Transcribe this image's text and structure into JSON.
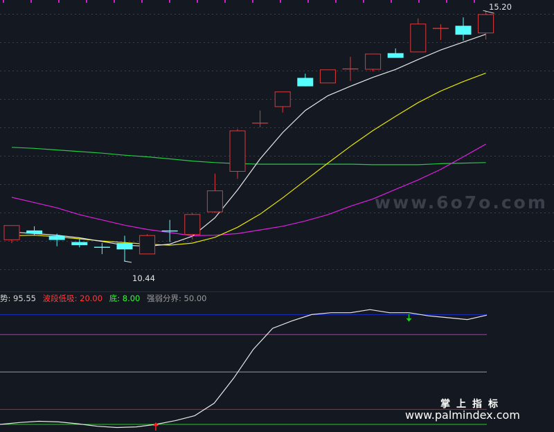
{
  "colors": {
    "background": "#141821",
    "up_candle": "#e0393b",
    "down_candle": "#55ffff",
    "ma_white": "#e8e8e8",
    "ma_yellow": "#e8e800",
    "ma_magenta": "#e020e0",
    "ma_green": "#22cc44",
    "osc_main": "#e8e8e8",
    "level_blue": "#1a2acc",
    "level_magenta": "#cc22cc",
    "level_gray": "#9a9a9a",
    "level_red": "#cc1e1e",
    "level_green": "#22cc22",
    "grid": "#3a3f4b"
  },
  "watermarks": {
    "site1": "www.6o7o.com",
    "brand": "掌上指标",
    "site2": "www.palmindex.com"
  },
  "chart_data": [
    {
      "type": "candlestick",
      "title": "",
      "ylim": [
        9.9,
        15.4
      ],
      "price_labels": {
        "high": "15.20",
        "low": "10.44"
      },
      "candles": [
        {
          "o": 10.85,
          "h": 11.05,
          "l": 10.78,
          "c": 11.12
        },
        {
          "o": 11.02,
          "h": 11.1,
          "l": 10.92,
          "c": 10.96
        },
        {
          "o": 10.92,
          "h": 10.96,
          "l": 10.72,
          "c": 10.84
        },
        {
          "o": 10.8,
          "h": 10.86,
          "l": 10.7,
          "c": 10.74
        },
        {
          "o": 10.71,
          "h": 10.78,
          "l": 10.57,
          "c": 10.69
        },
        {
          "o": 10.78,
          "h": 10.92,
          "l": 10.44,
          "c": 10.66
        },
        {
          "o": 10.58,
          "h": 10.95,
          "l": 10.58,
          "c": 10.93
        },
        {
          "o": 11.02,
          "h": 11.22,
          "l": 10.8,
          "c": 11.0
        },
        {
          "o": 10.95,
          "h": 11.35,
          "l": 10.85,
          "c": 11.33
        },
        {
          "o": 11.38,
          "h": 12.1,
          "l": 11.35,
          "c": 11.78
        },
        {
          "o": 12.15,
          "h": 12.95,
          "l": 12.0,
          "c": 12.92
        },
        {
          "o": 13.06,
          "h": 13.3,
          "l": 12.98,
          "c": 13.06
        },
        {
          "o": 13.38,
          "h": 13.58,
          "l": 13.26,
          "c": 13.66
        },
        {
          "o": 13.92,
          "h": 14.0,
          "l": 13.76,
          "c": 13.76
        },
        {
          "o": 13.83,
          "h": 14.05,
          "l": 13.82,
          "c": 14.08
        },
        {
          "o": 14.09,
          "h": 14.32,
          "l": 13.86,
          "c": 14.09
        },
        {
          "o": 14.09,
          "h": 14.37,
          "l": 14.04,
          "c": 14.38
        },
        {
          "o": 14.39,
          "h": 14.48,
          "l": 14.35,
          "c": 14.3
        },
        {
          "o": 14.42,
          "h": 15.05,
          "l": 14.42,
          "c": 14.95
        },
        {
          "o": 14.86,
          "h": 14.94,
          "l": 14.64,
          "c": 14.86
        },
        {
          "o": 14.91,
          "h": 15.07,
          "l": 14.63,
          "c": 14.74
        },
        {
          "o": 14.78,
          "h": 15.2,
          "l": 14.65,
          "c": 15.13
        }
      ],
      "ma_white": [
        10.99,
        10.96,
        10.93,
        10.88,
        10.81,
        10.74,
        10.72,
        10.76,
        10.91,
        11.26,
        11.79,
        12.38,
        12.88,
        13.3,
        13.58,
        13.76,
        13.93,
        14.08,
        14.27,
        14.45,
        14.6,
        14.75
      ],
      "ma_yellow": [
        10.92,
        10.93,
        10.9,
        10.86,
        10.82,
        10.79,
        10.76,
        10.74,
        10.78,
        10.89,
        11.08,
        11.33,
        11.64,
        11.97,
        12.3,
        12.62,
        12.92,
        13.19,
        13.45,
        13.67,
        13.85,
        14.01
      ],
      "ma_magenta": [
        11.65,
        11.55,
        11.45,
        11.32,
        11.22,
        11.12,
        11.04,
        10.98,
        10.92,
        10.93,
        10.96,
        11.03,
        11.1,
        11.2,
        11.32,
        11.48,
        11.62,
        11.8,
        11.98,
        12.18,
        12.42,
        12.66
      ],
      "ma_green": [
        12.6,
        12.58,
        12.55,
        12.52,
        12.49,
        12.45,
        12.42,
        12.38,
        12.34,
        12.31,
        12.29,
        12.28,
        12.28,
        12.28,
        12.28,
        12.28,
        12.27,
        12.27,
        12.27,
        12.29,
        12.3,
        12.31
      ]
    },
    {
      "type": "line",
      "title": "",
      "ylim": [
        3.0,
        104.0
      ],
      "legend": [
        {
          "label": "势: 95.55",
          "color": "#d8d8d8"
        },
        {
          "label": "波段低吸: 20.00",
          "color": "#ff3b3b"
        },
        {
          "label": "底: 8.00",
          "color": "#33ff33"
        },
        {
          "label": "强弱分界: 50.00",
          "color": "#9a9a9a"
        }
      ],
      "levels": [
        {
          "name": "high",
          "value": 96.0,
          "color": "#1a2acc"
        },
        {
          "name": "mid-high",
          "value": 80.0,
          "color": "#cc22cc"
        },
        {
          "name": "强弱分界",
          "value": 50.0,
          "color": "#9a9a9a"
        },
        {
          "name": "波段低吸",
          "value": 20.0,
          "color": "#cc1e1e"
        },
        {
          "name": "底",
          "value": 8.0,
          "color": "#22cc22"
        }
      ],
      "series": [
        {
          "values": [
            8.0,
            9.5,
            10.5,
            10.0,
            8.5,
            6.5,
            5.5,
            6.0,
            8.0,
            11.0,
            15.0,
            25.0,
            45.0,
            68.0,
            85.0,
            91.0,
            96.0,
            97.5,
            97.5,
            100.0,
            97.5,
            97.5,
            95.0,
            93.5,
            92.0,
            95.55
          ]
        }
      ],
      "signals": [
        {
          "type": "buy",
          "index": 8,
          "color": "#ff2222"
        },
        {
          "type": "sell",
          "index": 21,
          "color": "#22cc22"
        }
      ]
    }
  ]
}
